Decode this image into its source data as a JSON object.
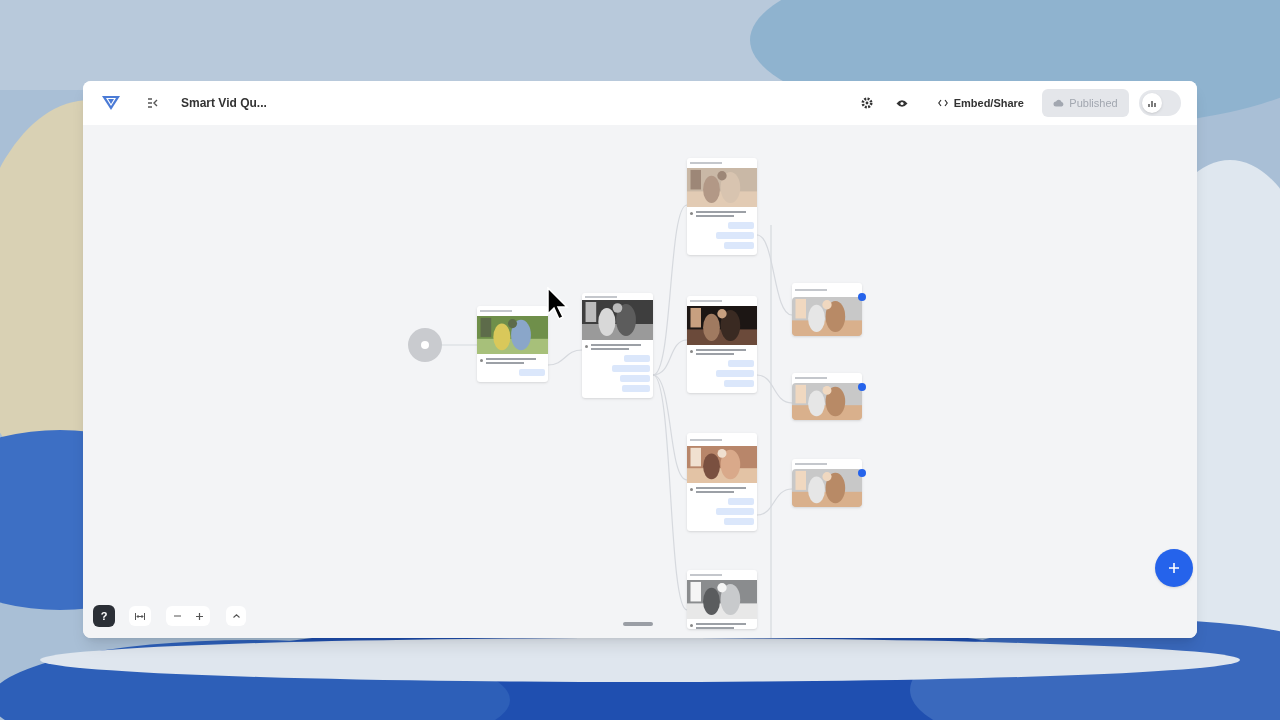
{
  "window": {
    "title": "Smart Vid Qu..."
  },
  "toolbar": {
    "embed_label": "Embed/Share",
    "publish": {
      "label": "Published",
      "disabled": true
    },
    "toggle": {
      "on": false
    }
  },
  "canvas_controls": {
    "help": "?"
  }
}
